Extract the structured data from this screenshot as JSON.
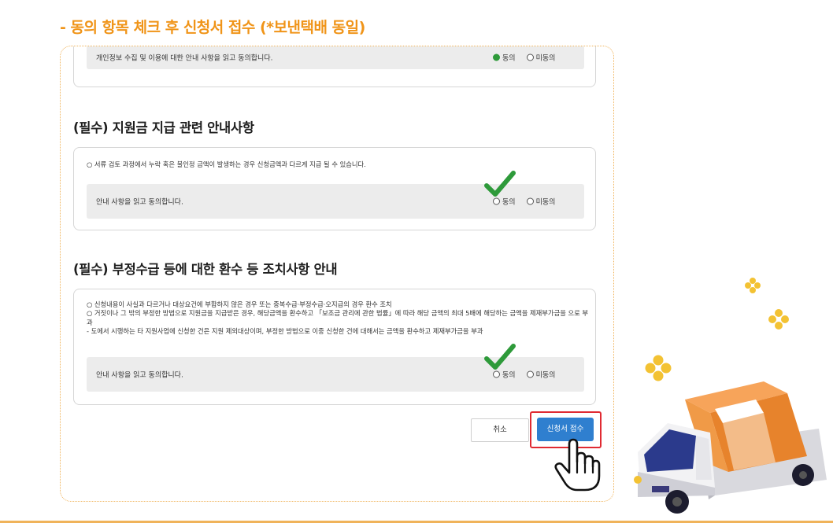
{
  "heading": "- 동의 항목 체크 후 신청서 접수 (*보낸택배 동일)",
  "section1": {
    "agree_text": "개인정보 수집 및 이용에 대한 안내 사항을 읽고 동의합니다.",
    "agree_label": "동의",
    "disagree_label": "미동의"
  },
  "section2": {
    "title": "(필수) 지원금 지급 관련 안내사항",
    "notice": "○ 서류 검토 과정에서 누락 혹은 불인정 금액이 발생하는 경우 신청금액과 다르게 지급 될 수 있습니다.",
    "agree_text": "안내 사항을 읽고 동의합니다.",
    "agree_label": "동의",
    "disagree_label": "미동의"
  },
  "section3": {
    "title": "(필수) 부정수급 등에 대한 환수 등 조치사항 안내",
    "notice_lines": [
      "○ 신청내용이 사실과 다르거나 대상요건에 부합하지 않은 경우 또는 중복수급·부정수급·오지급의 경우 환수 조치",
      "○ 거짓이나 그 밖의 부정한 방법으로 지원금을 지급받은 경우, 해당금액을 환수하고 「보조금 관리에 관한 법률」에 따라 해당 금액의 최대 5배에 해당하는 금액을 제재부가금을 으로 부과",
      "- 도에서 시행하는 타 지원사업에 신청한 건은 지원 제외대상이며, 부정한 방법으로 이중 신청한 건에 대해서는 금액을 환수하고 제재부가금을 부과"
    ],
    "agree_text": "안내 사항을 읽고 동의합니다.",
    "agree_label": "동의",
    "disagree_label": "미동의"
  },
  "buttons": {
    "cancel": "취소",
    "submit": "신청서 접수"
  },
  "colors": {
    "accent_orange": "#f09418",
    "submit_blue": "#2f7fcf",
    "highlight_red": "#e02a32",
    "check_green": "#2e9a3a"
  },
  "icons": [
    "check-mark-icon",
    "pointer-hand-icon",
    "delivery-truck-illustration",
    "sparkle-decoration"
  ]
}
